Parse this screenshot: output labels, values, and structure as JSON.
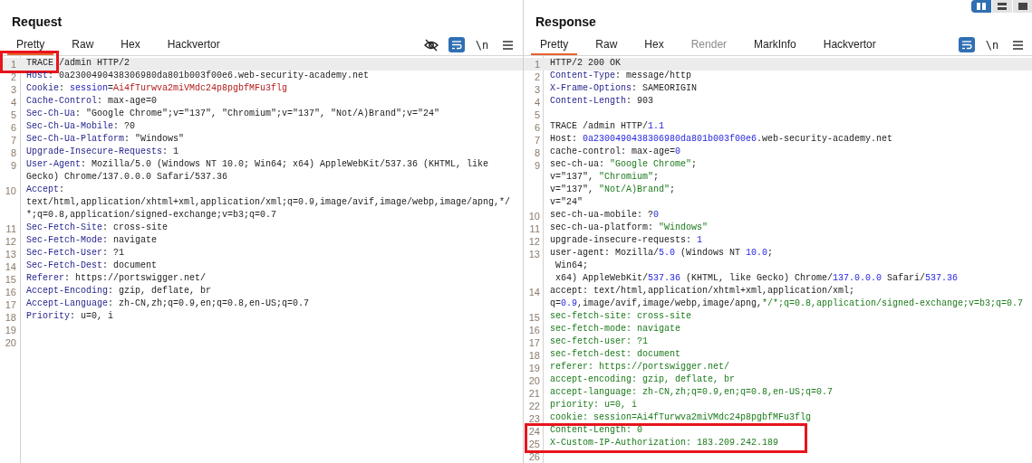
{
  "view_toggles": [
    {
      "kind": "columns",
      "selected": true
    },
    {
      "kind": "rows",
      "selected": false
    },
    {
      "kind": "single",
      "selected": false
    }
  ],
  "panes": [
    {
      "title": "Request",
      "tabs": [
        {
          "label": "Pretty",
          "selected": true,
          "disabled": false
        },
        {
          "label": "Raw",
          "selected": false,
          "disabled": false
        },
        {
          "label": "Hex",
          "selected": false,
          "disabled": false
        },
        {
          "label": "Hackvertor",
          "selected": false,
          "disabled": false
        }
      ],
      "tools": [
        {
          "kind": "hide"
        },
        {
          "kind": "wrap",
          "on": true
        },
        {
          "kind": "newline",
          "label": "\\n"
        },
        {
          "kind": "menu"
        }
      ],
      "rows": [
        {
          "n": "1",
          "hl": true,
          "boxed": true,
          "seg": [
            {
              "text": "TRACE /admin HTTP/2",
              "kind": "plain"
            }
          ]
        },
        {
          "n": "2",
          "seg": [
            {
              "text": "Host",
              "kind": "key"
            },
            {
              "text": ": 0a2300490438306980da801b003f00e6.web-security-academy.net",
              "kind": "plain"
            }
          ]
        },
        {
          "n": "3",
          "seg": [
            {
              "text": "Cookie",
              "kind": "key"
            },
            {
              "text": ": ",
              "kind": "plain"
            },
            {
              "text": "session",
              "kind": "param"
            },
            {
              "text": "=",
              "kind": "plain"
            },
            {
              "text": "Ai4fTurwva2miVMdc24p8pgbfMFu3flg",
              "kind": "secret"
            }
          ]
        },
        {
          "n": "4",
          "seg": [
            {
              "text": "Cache-Control",
              "kind": "key"
            },
            {
              "text": ": max-age=0",
              "kind": "plain"
            }
          ]
        },
        {
          "n": "5",
          "seg": [
            {
              "text": "Sec-Ch-Ua",
              "kind": "key"
            },
            {
              "text": ": \"Google Chrome\";v=\"137\", \"Chromium\";v=\"137\", \"Not/A)Brand\";v=\"24\"",
              "kind": "plain"
            }
          ]
        },
        {
          "n": "6",
          "seg": [
            {
              "text": "Sec-Ch-Ua-Mobile",
              "kind": "key"
            },
            {
              "text": ": ?0",
              "kind": "plain"
            }
          ]
        },
        {
          "n": "7",
          "seg": [
            {
              "text": "Sec-Ch-Ua-Platform",
              "kind": "key"
            },
            {
              "text": ": \"Windows\"",
              "kind": "plain"
            }
          ]
        },
        {
          "n": "8",
          "seg": [
            {
              "text": "Upgrade-Insecure-Requests",
              "kind": "key"
            },
            {
              "text": ": 1",
              "kind": "plain"
            }
          ]
        },
        {
          "n": "9",
          "seg": [
            {
              "text": "User-Agent",
              "kind": "key"
            },
            {
              "text": ": Mozilla/5.0 (Windows NT 10.0; Win64; x64) AppleWebKit/537.36 (KHTML, like",
              "kind": "plain"
            }
          ]
        },
        {
          "seg": [
            {
              "text": "Gecko) Chrome/137.0.0.0 Safari/537.36",
              "kind": "plain"
            }
          ]
        },
        {
          "n": "10",
          "seg": [
            {
              "text": "Accept",
              "kind": "key"
            },
            {
              "text": ":",
              "kind": "plain"
            }
          ]
        },
        {
          "seg": [
            {
              "text": "text/html,application/xhtml+xml,application/xml;q=0.9,image/avif,image/webp,image/apng,*/",
              "kind": "plain"
            }
          ]
        },
        {
          "seg": [
            {
              "text": "*;q=0.8,application/signed-exchange;v=b3;q=0.7",
              "kind": "plain"
            }
          ]
        },
        {
          "n": "11",
          "seg": [
            {
              "text": "Sec-Fetch-Site",
              "kind": "key"
            },
            {
              "text": ": cross-site",
              "kind": "plain"
            }
          ]
        },
        {
          "n": "12",
          "seg": [
            {
              "text": "Sec-Fetch-Mode",
              "kind": "key"
            },
            {
              "text": ": navigate",
              "kind": "plain"
            }
          ]
        },
        {
          "n": "13",
          "seg": [
            {
              "text": "Sec-Fetch-User",
              "kind": "key"
            },
            {
              "text": ": ?1",
              "kind": "plain"
            }
          ]
        },
        {
          "n": "14",
          "seg": [
            {
              "text": "Sec-Fetch-Dest",
              "kind": "key"
            },
            {
              "text": ": document",
              "kind": "plain"
            }
          ]
        },
        {
          "n": "15",
          "seg": [
            {
              "text": "Referer",
              "kind": "key"
            },
            {
              "text": ": https://portswigger.net/",
              "kind": "plain"
            }
          ]
        },
        {
          "n": "16",
          "seg": [
            {
              "text": "Accept-Encoding",
              "kind": "key"
            },
            {
              "text": ": gzip, deflate, br",
              "kind": "plain"
            }
          ]
        },
        {
          "n": "17",
          "seg": [
            {
              "text": "Accept-Language",
              "kind": "key"
            },
            {
              "text": ": zh-CN,zh;q=0.9,en;q=0.8,en-US;q=0.7",
              "kind": "plain"
            }
          ]
        },
        {
          "n": "18",
          "seg": [
            {
              "text": "Priority",
              "kind": "key"
            },
            {
              "text": ": u=0, i",
              "kind": "plain"
            }
          ]
        },
        {
          "n": "19",
          "seg": []
        },
        {
          "n": "20",
          "seg": []
        }
      ]
    },
    {
      "title": "Response",
      "tabs": [
        {
          "label": "Pretty",
          "selected": true,
          "disabled": false
        },
        {
          "label": "Raw",
          "selected": false,
          "disabled": false
        },
        {
          "label": "Hex",
          "selected": false,
          "disabled": false
        },
        {
          "label": "Render",
          "selected": false,
          "disabled": true
        },
        {
          "label": "MarkInfo",
          "selected": false,
          "disabled": false
        },
        {
          "label": "Hackvertor",
          "selected": false,
          "disabled": false
        }
      ],
      "tools": [
        {
          "kind": "wrap",
          "on": true
        },
        {
          "kind": "newline",
          "label": "\\n"
        },
        {
          "kind": "menu"
        }
      ],
      "rows": [
        {
          "n": "1",
          "hl": true,
          "seg": [
            {
              "text": "HTTP/2 200 OK",
              "kind": "plain"
            }
          ]
        },
        {
          "n": "2",
          "seg": [
            {
              "text": "Content-Type",
              "kind": "key"
            },
            {
              "text": ": message/http",
              "kind": "plain"
            }
          ]
        },
        {
          "n": "3",
          "seg": [
            {
              "text": "X-Frame-Options",
              "kind": "key"
            },
            {
              "text": ": SAMEORIGIN",
              "kind": "plain"
            }
          ]
        },
        {
          "n": "4",
          "seg": [
            {
              "text": "Content-Length",
              "kind": "key"
            },
            {
              "text": ": 903",
              "kind": "plain"
            }
          ]
        },
        {
          "n": "5",
          "seg": []
        },
        {
          "n": "6",
          "seg": [
            {
              "text": "TRACE /admin HTTP/",
              "kind": "plain"
            },
            {
              "text": "1.1",
              "kind": "number"
            }
          ]
        },
        {
          "n": "7",
          "seg": [
            {
              "text": "Host: ",
              "kind": "plain"
            },
            {
              "text": "0a2300490438306980da801b003f00e6",
              "kind": "number"
            },
            {
              "text": ".web-security-academy.net",
              "kind": "plain"
            }
          ]
        },
        {
          "n": "8",
          "seg": [
            {
              "text": "cache-control: max-age=",
              "kind": "plain"
            },
            {
              "text": "0",
              "kind": "number"
            }
          ]
        },
        {
          "n": "9",
          "seg": [
            {
              "text": "sec-ch-ua: ",
              "kind": "plain"
            },
            {
              "text": "\"Google Chrome\"",
              "kind": "string"
            },
            {
              "text": ";",
              "kind": "plain"
            }
          ]
        },
        {
          "seg": [
            {
              "text": "v=\"137\", ",
              "kind": "plain"
            },
            {
              "text": "\"Chromium\"",
              "kind": "string"
            },
            {
              "text": ";",
              "kind": "plain"
            }
          ]
        },
        {
          "seg": [
            {
              "text": "v=\"137\", ",
              "kind": "plain"
            },
            {
              "text": "\"Not/A)Brand\"",
              "kind": "string"
            },
            {
              "text": ";",
              "kind": "plain"
            }
          ]
        },
        {
          "seg": [
            {
              "text": "v=\"24\"",
              "kind": "plain"
            }
          ]
        },
        {
          "n": "10",
          "seg": [
            {
              "text": "sec-ch-ua-mobile: ?",
              "kind": "plain"
            },
            {
              "text": "0",
              "kind": "number"
            }
          ]
        },
        {
          "n": "11",
          "seg": [
            {
              "text": "sec-ch-ua-platform: ",
              "kind": "plain"
            },
            {
              "text": "\"Windows\"",
              "kind": "string"
            }
          ]
        },
        {
          "n": "12",
          "seg": [
            {
              "text": "upgrade-insecure-requests: ",
              "kind": "plain"
            },
            {
              "text": "1",
              "kind": "number"
            }
          ]
        },
        {
          "n": "13",
          "seg": [
            {
              "text": "user-agent: Mozilla/",
              "kind": "plain"
            },
            {
              "text": "5.0",
              "kind": "number"
            },
            {
              "text": " (Windows NT ",
              "kind": "plain"
            },
            {
              "text": "10.0",
              "kind": "number"
            },
            {
              "text": ";",
              "kind": "plain"
            }
          ]
        },
        {
          "seg": [
            {
              "text": " Win64;",
              "kind": "plain"
            }
          ]
        },
        {
          "seg": [
            {
              "text": " x64) AppleWebKit/",
              "kind": "plain"
            },
            {
              "text": "537.36",
              "kind": "number"
            },
            {
              "text": " (KHTML, like Gecko) Chrome/",
              "kind": "plain"
            },
            {
              "text": "137.0.0.0",
              "kind": "number"
            },
            {
              "text": " Safari/",
              "kind": "plain"
            },
            {
              "text": "537.36",
              "kind": "number"
            }
          ]
        },
        {
          "n": "14",
          "seg": [
            {
              "text": "accept: text/html,application/xhtml+xml,application/xml;",
              "kind": "plain"
            }
          ]
        },
        {
          "seg": [
            {
              "text": "q=",
              "kind": "plain"
            },
            {
              "text": "0.9",
              "kind": "number"
            },
            {
              "text": ",image/avif,image/webp,image/apng,",
              "kind": "plain"
            },
            {
              "text": "*/*;q=0.8,application/signed-exchange;v=b3;q=0.7",
              "kind": "string"
            }
          ]
        },
        {
          "n": "15",
          "seg": [
            {
              "text": "sec-fetch-site: cross-site",
              "kind": "string"
            }
          ]
        },
        {
          "n": "16",
          "seg": [
            {
              "text": "sec-fetch-mode: navigate",
              "kind": "string"
            }
          ]
        },
        {
          "n": "17",
          "seg": [
            {
              "text": "sec-fetch-user: ?1",
              "kind": "string"
            }
          ]
        },
        {
          "n": "18",
          "seg": [
            {
              "text": "sec-fetch-dest: document",
              "kind": "string"
            }
          ]
        },
        {
          "n": "19",
          "seg": [
            {
              "text": "referer: https://portswigger.net/",
              "kind": "string"
            }
          ]
        },
        {
          "n": "20",
          "seg": [
            {
              "text": "accept-encoding: gzip, deflate, br",
              "kind": "string"
            }
          ]
        },
        {
          "n": "21",
          "seg": [
            {
              "text": "accept-language: zh-CN,zh;q=0.9,en;q=0.8,en-US;q=0.7",
              "kind": "string"
            }
          ]
        },
        {
          "n": "22",
          "seg": [
            {
              "text": "priority: u=0, i",
              "kind": "string"
            }
          ]
        },
        {
          "n": "23",
          "seg": [
            {
              "text": "cookie: session=Ai4fTurwva2miVMdc24p8pgbfMFu3flg",
              "kind": "string"
            }
          ]
        },
        {
          "n": "24",
          "boxed": true,
          "seg": [
            {
              "text": "Content-Length: 0",
              "kind": "string"
            }
          ]
        },
        {
          "n": "25",
          "boxed": true,
          "seg": [
            {
              "text": "X-Custom-IP-Authorization: 183.209.242.189",
              "kind": "string"
            }
          ]
        },
        {
          "n": "26",
          "seg": []
        }
      ]
    }
  ]
}
